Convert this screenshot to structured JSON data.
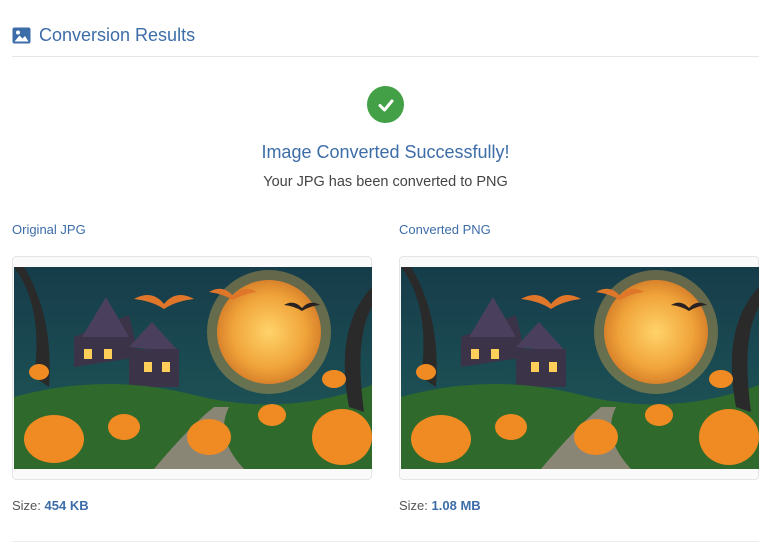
{
  "header": {
    "title": "Conversion Results",
    "icon": "image-icon",
    "accent": "#3d6da8"
  },
  "status": {
    "icon": "check-circle-icon",
    "color": "#43a047",
    "title": "Image Converted Successfully!",
    "message": "Your JPG has been converted to PNG"
  },
  "original": {
    "label": "Original JPG",
    "size_label": "Size:",
    "size_value": "454 KB"
  },
  "converted": {
    "label": "Converted PNG",
    "size_label": "Size:",
    "size_value": "1.08 MB"
  }
}
